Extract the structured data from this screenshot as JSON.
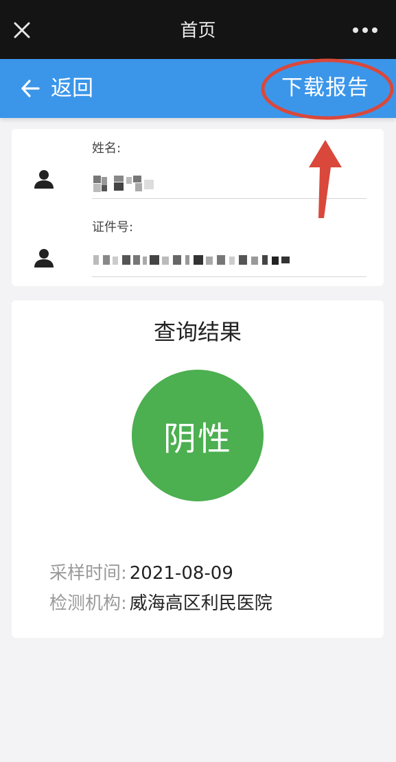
{
  "window": {
    "title": "首页"
  },
  "navbar": {
    "back_label": "返回",
    "download_label": "下载报告"
  },
  "info": {
    "name_label": "姓名:",
    "id_label": "证件号:"
  },
  "result": {
    "title": "查询结果",
    "status": "阴性",
    "status_color": "#4caf50",
    "sample_time_label": "采样时间:",
    "sample_time_value": "2021-08-09",
    "institution_label": "检测机构:",
    "institution_value": "威海高区利民医院"
  },
  "colors": {
    "topbar": "#141414",
    "navbar": "#3b96ea",
    "annotation": "#d9483b"
  },
  "icons": [
    "close-icon",
    "more-icon",
    "back-arrow-icon",
    "person-icon"
  ]
}
